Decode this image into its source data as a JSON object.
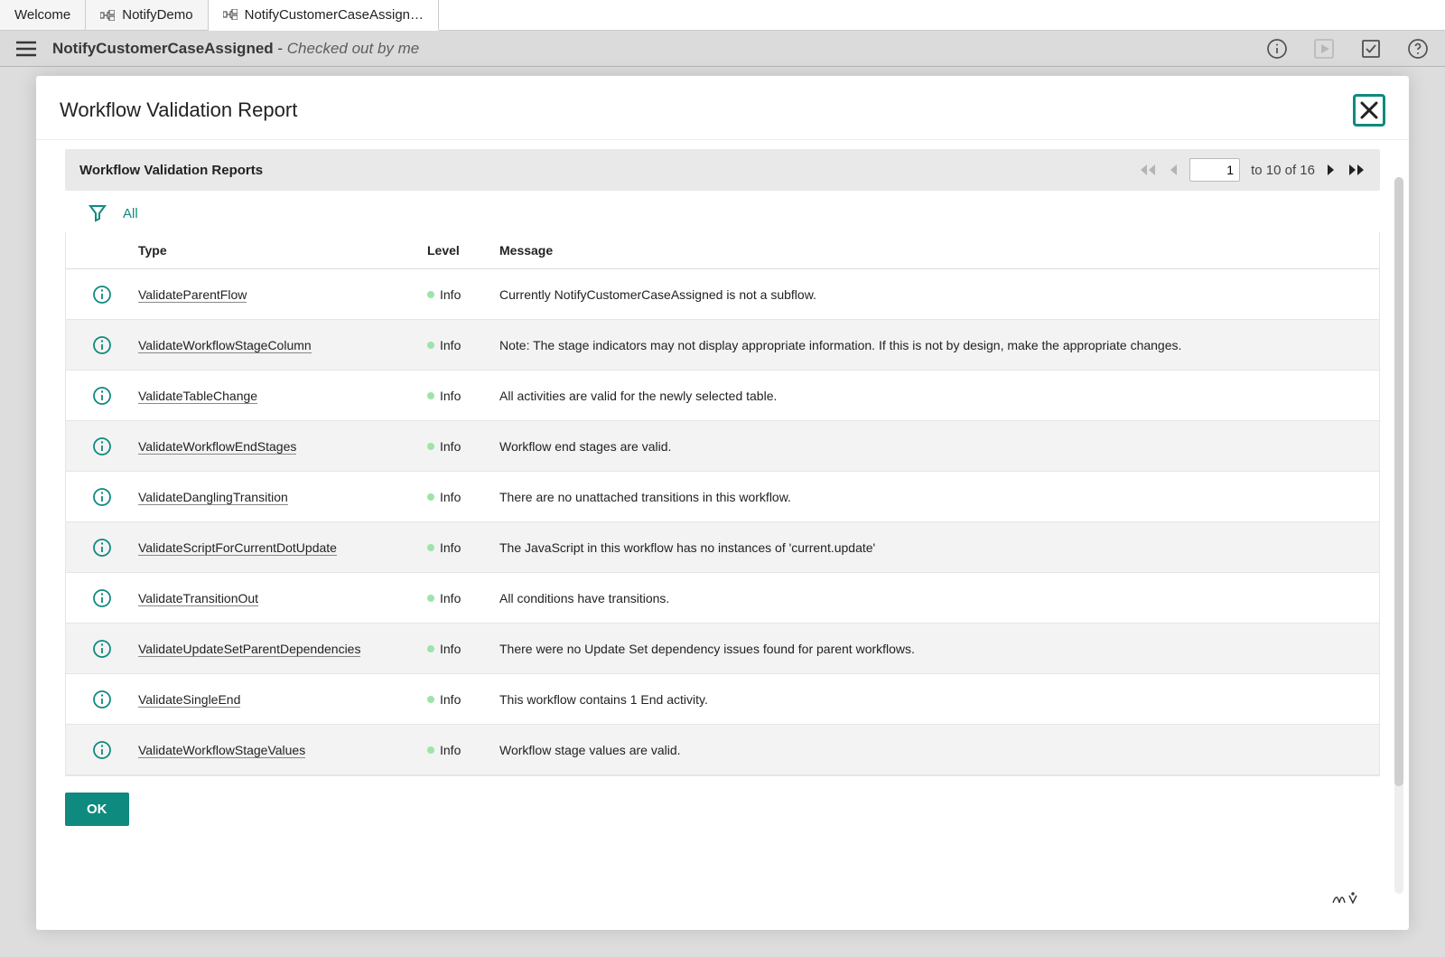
{
  "tabs": [
    {
      "label": "Welcome",
      "has_wf_icon": false,
      "active": false
    },
    {
      "label": "NotifyDemo",
      "has_wf_icon": true,
      "active": false
    },
    {
      "label": "NotifyCustomerCaseAssign…",
      "has_wf_icon": true,
      "active": true
    }
  ],
  "page_header": {
    "title_bold": "NotifyCustomerCaseAssigned",
    "title_sep": " - ",
    "title_italic": "Checked out by me"
  },
  "modal": {
    "title": "Workflow Validation Report",
    "grid_title": "Workflow Validation Reports",
    "pager": {
      "page": "1",
      "range": "to 10 of 16"
    },
    "filter_link": "All",
    "columns": {
      "type": "Type",
      "level": "Level",
      "message": "Message"
    },
    "rows": [
      {
        "type": "ValidateParentFlow",
        "level": "Info",
        "msg": "Currently NotifyCustomerCaseAssigned is not a subflow."
      },
      {
        "type": "ValidateWorkflowStageColumn",
        "level": "Info",
        "msg": "Note: The stage indicators may not display appropriate information. If this is not by design, make the appropriate changes."
      },
      {
        "type": "ValidateTableChange",
        "level": "Info",
        "msg": "All activities are valid for the newly selected table."
      },
      {
        "type": "ValidateWorkflowEndStages",
        "level": "Info",
        "msg": "Workflow end stages are valid."
      },
      {
        "type": "ValidateDanglingTransition",
        "level": "Info",
        "msg": "There are no unattached transitions in this workflow."
      },
      {
        "type": "ValidateScriptForCurrentDotUpdate",
        "level": "Info",
        "msg": "The JavaScript in this workflow has no instances of 'current.update'"
      },
      {
        "type": "ValidateTransitionOut",
        "level": "Info",
        "msg": "All conditions have transitions."
      },
      {
        "type": "ValidateUpdateSetParentDependencies",
        "level": "Info",
        "msg": "There were no Update Set dependency issues found for parent workflows."
      },
      {
        "type": "ValidateSingleEnd",
        "level": "Info",
        "msg": "This workflow contains 1 End activity."
      },
      {
        "type": "ValidateWorkflowStageValues",
        "level": "Info",
        "msg": "Workflow stage values are valid."
      }
    ],
    "ok": "OK"
  }
}
